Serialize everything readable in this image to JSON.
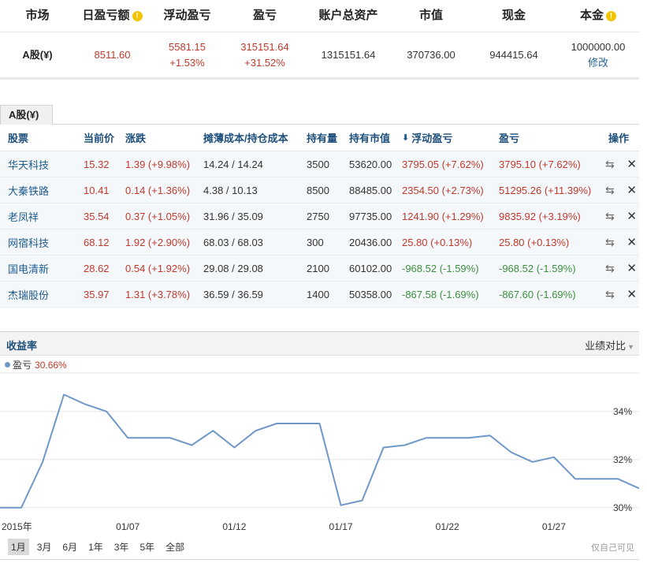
{
  "summary": {
    "headers": [
      "市场",
      "日盈亏额",
      "浮动盈亏",
      "盈亏",
      "账户总资产",
      "市值",
      "现金",
      "本金"
    ],
    "info_icon_glyph": "!",
    "row": {
      "market": "A股(¥)",
      "daily_pnl": "8511.60",
      "float_pnl": "5581.15",
      "float_pnl_pct": "+1.53%",
      "pnl": "315151.64",
      "pnl_pct": "+31.52%",
      "total_assets": "1315151.64",
      "market_value": "370736.00",
      "cash": "944415.64",
      "principal": "1000000.00",
      "edit_label": "修改"
    }
  },
  "tab": {
    "label": "A股(¥)"
  },
  "holdings": {
    "headers": [
      "股票",
      "当前价",
      "涨跌",
      "摊薄成本/持仓成本",
      "持有量",
      "持有市值",
      "浮动盈亏",
      "盈亏",
      "操作"
    ],
    "sort_arrow": "⬇",
    "rows": [
      {
        "name": "华天科技",
        "price": "15.32",
        "change": "1.39 (+9.98%)",
        "cost": "14.24 / 14.24",
        "qty": "3500",
        "value": "53620.00",
        "float_pnl": "3795.05 (+7.62%)",
        "pnl": "3795.10 (+7.62%)",
        "dir": "up"
      },
      {
        "name": "大秦铁路",
        "price": "10.41",
        "change": "0.14 (+1.36%)",
        "cost": "4.38 / 10.13",
        "qty": "8500",
        "value": "88485.00",
        "float_pnl": "2354.50 (+2.73%)",
        "pnl": "51295.26 (+11.39%)",
        "dir": "up"
      },
      {
        "name": "老凤祥",
        "price": "35.54",
        "change": "0.37 (+1.05%)",
        "cost": "31.96 / 35.09",
        "qty": "2750",
        "value": "97735.00",
        "float_pnl": "1241.90 (+1.29%)",
        "pnl": "9835.92 (+3.19%)",
        "dir": "up"
      },
      {
        "name": "网宿科技",
        "price": "68.12",
        "change": "1.92 (+2.90%)",
        "cost": "68.03 / 68.03",
        "qty": "300",
        "value": "20436.00",
        "float_pnl": "25.80 (+0.13%)",
        "pnl": "25.80 (+0.13%)",
        "dir": "up"
      },
      {
        "name": "国电清新",
        "price": "28.62",
        "change": "0.54 (+1.92%)",
        "cost": "29.08 / 29.08",
        "qty": "2100",
        "value": "60102.00",
        "float_pnl": "-968.52 (-1.59%)",
        "pnl": "-968.52 (-1.59%)",
        "dir": "down"
      },
      {
        "name": "杰瑞股份",
        "price": "35.97",
        "change": "1.31 (+3.78%)",
        "cost": "36.59 / 36.59",
        "qty": "1400",
        "value": "50358.00",
        "float_pnl": "-867.58 (-1.69%)",
        "pnl": "-867.60 (-1.69%)",
        "dir": "down"
      }
    ],
    "op_icons": {
      "transfer": "⇆",
      "close": "✕"
    }
  },
  "chart": {
    "title": "收益率",
    "compare_label": "业绩对比",
    "legend_name": "盈亏",
    "legend_value": "30.66%",
    "ranges": [
      "1月",
      "3月",
      "6月",
      "1年",
      "3年",
      "5年",
      "全部"
    ],
    "active_range": "1月",
    "watermark": "仅自己可见",
    "colors": {
      "line": "#6f98c8",
      "grid": "#e6e6e6",
      "positive": "#c0392b",
      "negative": "#3c8f3c"
    }
  },
  "chart_data": {
    "type": "line",
    "title": "收益率",
    "xlabel": "",
    "ylabel": "",
    "x_tick_labels": [
      "2015年",
      "01/07",
      "01/12",
      "01/17",
      "01/22",
      "01/27"
    ],
    "x_tick_index": [
      0,
      6,
      11,
      16,
      21,
      26
    ],
    "y_tick_labels": [
      "30%",
      "32%",
      "34%"
    ],
    "y_tick_values": [
      30,
      32,
      34
    ],
    "ylim": [
      29.5,
      35.6
    ],
    "grid": true,
    "legend": "top-left",
    "series": [
      {
        "name": "盈亏",
        "x": [
          "01/01",
          "01/02",
          "01/03",
          "01/04",
          "01/05",
          "01/06",
          "01/07",
          "01/08",
          "01/09",
          "01/10",
          "01/11",
          "01/12",
          "01/13",
          "01/14",
          "01/15",
          "01/16",
          "01/17",
          "01/18",
          "01/19",
          "01/20",
          "01/21",
          "01/22",
          "01/23",
          "01/24",
          "01/25",
          "01/26",
          "01/27",
          "01/28",
          "01/29",
          "01/30",
          "01/31"
        ],
        "values": [
          30.0,
          30.0,
          31.9,
          34.7,
          34.3,
          34.0,
          32.9,
          32.9,
          32.9,
          32.6,
          33.2,
          32.5,
          33.2,
          33.5,
          33.5,
          33.5,
          30.1,
          30.3,
          32.5,
          32.6,
          32.9,
          32.9,
          32.9,
          33.0,
          32.3,
          31.9,
          32.1,
          31.2,
          31.2,
          31.2,
          30.8
        ]
      }
    ]
  }
}
